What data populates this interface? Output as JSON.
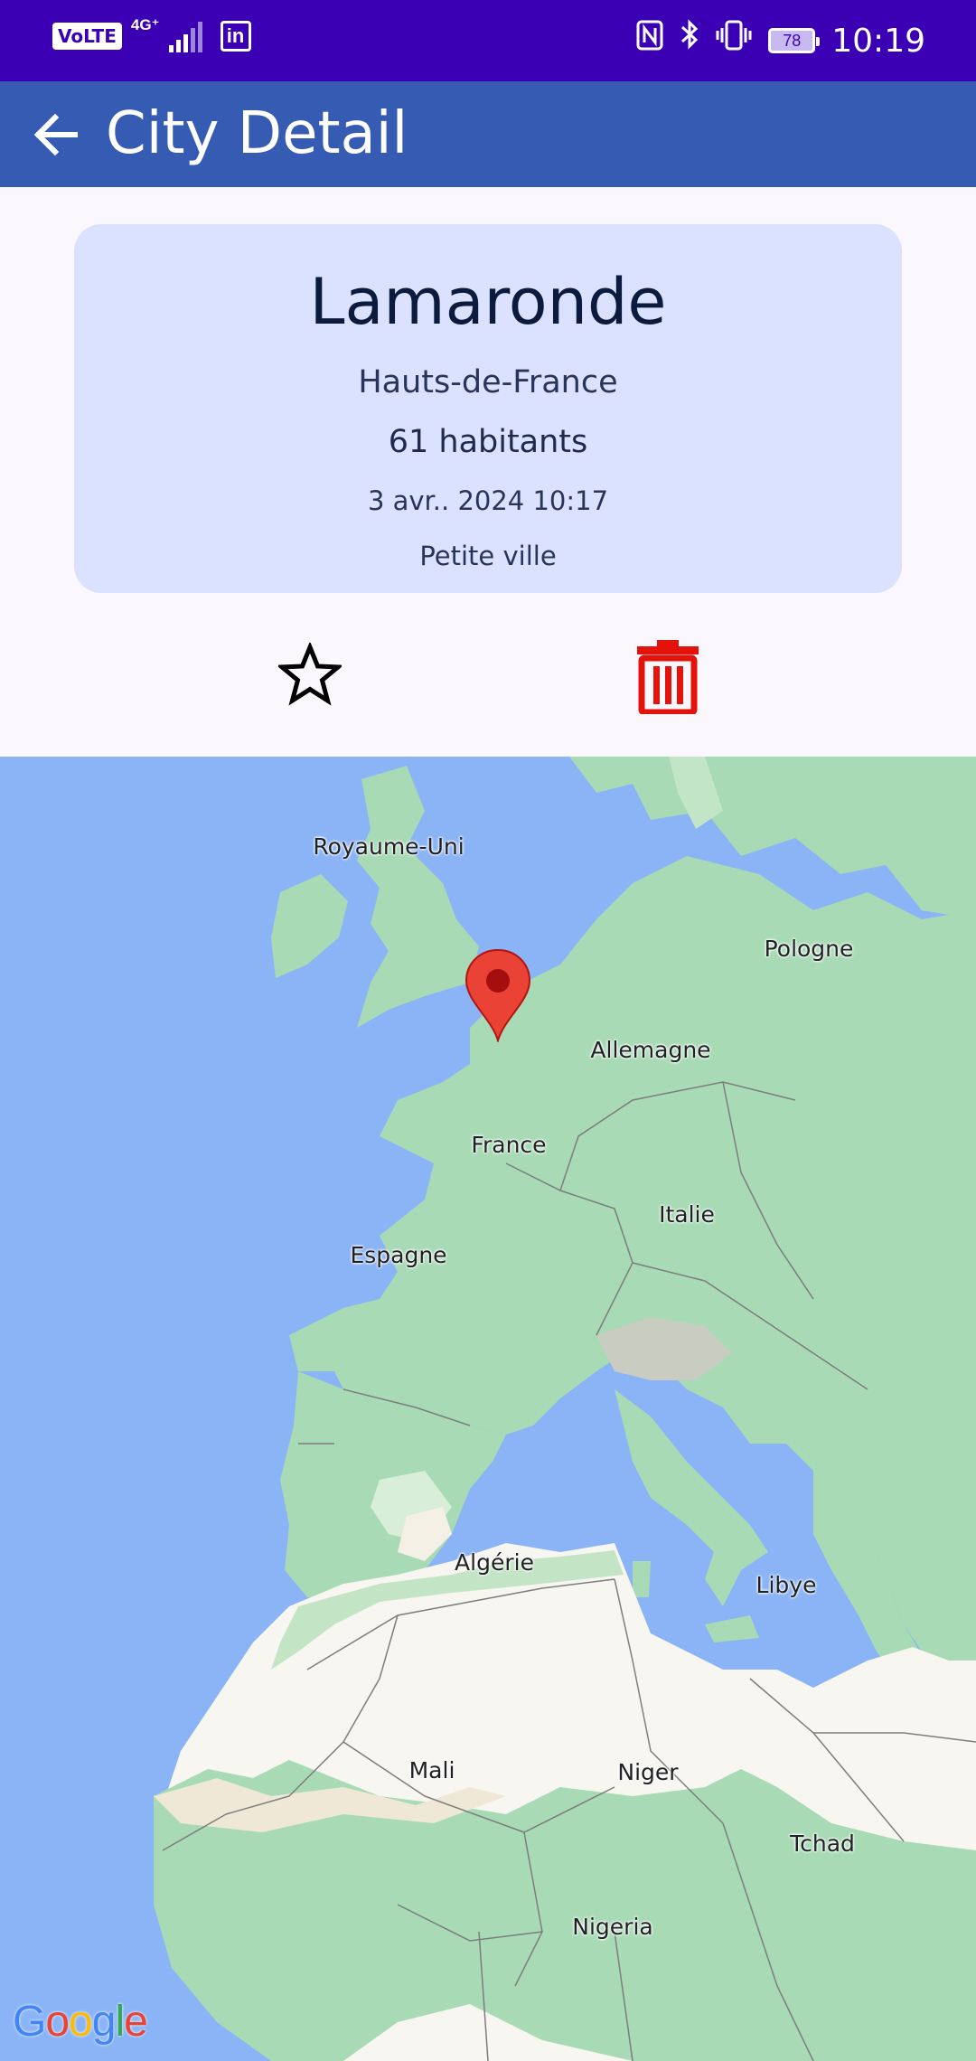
{
  "status_bar": {
    "volte": "VoLTE",
    "network": "4G⁺",
    "app_icon": "in",
    "battery": "78",
    "time": "10:19"
  },
  "app_bar": {
    "title": "City Detail",
    "back_icon": "arrow-left"
  },
  "city": {
    "name": "Lamaronde",
    "region": "Hauts-de-France",
    "population": "61 habitants",
    "date": "3 avr.. 2024 10:17",
    "category": "Petite ville"
  },
  "actions": {
    "favorite_icon": "star-outline",
    "delete_icon": "trash",
    "delete_color": "#e3120b"
  },
  "map": {
    "labels": {
      "uk": "Royaume-Uni",
      "poland": "Pologne",
      "germany": "Allemagne",
      "france": "France",
      "italy": "Italie",
      "spain": "Espagne",
      "algeria": "Algérie",
      "libya": "Libye",
      "mali": "Mali",
      "niger": "Niger",
      "chad": "Tchad",
      "nigeria": "Nigeria"
    },
    "marker_color": "#ea4335",
    "attribution": "Google"
  }
}
